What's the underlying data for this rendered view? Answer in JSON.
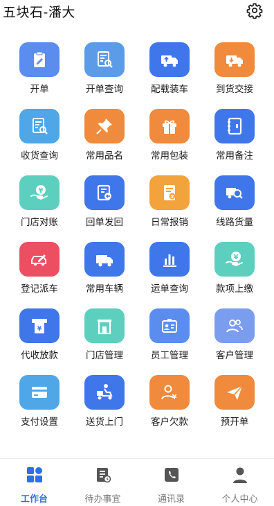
{
  "header": {
    "title": "五块石-潘大",
    "settings_icon": "gear-icon"
  },
  "colors": {
    "accent": "#2f6fe6",
    "tab_inactive": "#777777"
  },
  "grid": [
    {
      "label": "开单",
      "icon": "clipboard-pen-icon",
      "color": "#5b8def"
    },
    {
      "label": "开单查询",
      "icon": "document-search-icon",
      "color": "#5b9be8"
    },
    {
      "label": "配载装车",
      "icon": "truck-load-icon",
      "color": "#3f76ea"
    },
    {
      "label": "到货交接",
      "icon": "truck-unload-icon",
      "color": "#f08a3c"
    },
    {
      "label": "收货查询",
      "icon": "document-search-icon",
      "color": "#4fa7e8"
    },
    {
      "label": "常用品名",
      "icon": "pin-icon",
      "color": "#f08a3c"
    },
    {
      "label": "常用包装",
      "icon": "gift-box-icon",
      "color": "#f08a3c"
    },
    {
      "label": "常用备注",
      "icon": "notebook-icon",
      "color": "#3f76ea"
    },
    {
      "label": "门店对账",
      "icon": "yen-hand-icon",
      "color": "#5ccfbf"
    },
    {
      "label": "回单发回",
      "icon": "receipt-return-icon",
      "color": "#3f76ea"
    },
    {
      "label": "日常报销",
      "icon": "expense-receipt-icon",
      "color": "#f2a33c"
    },
    {
      "label": "线路货量",
      "icon": "truck-search-icon",
      "color": "#3f76ea"
    },
    {
      "label": "登记派车",
      "icon": "vehicle-register-icon",
      "color": "#ec4e62"
    },
    {
      "label": "常用车辆",
      "icon": "truck-icon",
      "color": "#3f76ea"
    },
    {
      "label": "运单查询",
      "icon": "bar-chart-icon",
      "color": "#3f76ea"
    },
    {
      "label": "款项上缴",
      "icon": "yen-hand-icon",
      "color": "#5ccfbf"
    },
    {
      "label": "代收放款",
      "icon": "atm-yen-icon",
      "color": "#3f76ea"
    },
    {
      "label": "门店管理",
      "icon": "store-icon",
      "color": "#5ccfbf"
    },
    {
      "label": "员工管理",
      "icon": "id-badge-icon",
      "color": "#5b8def"
    },
    {
      "label": "客户管理",
      "icon": "users-icon",
      "color": "#7a9df0"
    },
    {
      "label": "支付设置",
      "icon": "credit-card-icon",
      "color": "#4fa7e8"
    },
    {
      "label": "送货上门",
      "icon": "delivery-scooter-icon",
      "color": "#3f76ea"
    },
    {
      "label": "客户欠款",
      "icon": "user-debt-icon",
      "color": "#f08a3c"
    },
    {
      "label": "预开单",
      "icon": "paper-plane-icon",
      "color": "#f08a3c"
    }
  ],
  "tabbar": [
    {
      "label": "工作台",
      "icon": "workbench-grid-icon",
      "active": true
    },
    {
      "label": "待办事宜",
      "icon": "todo-list-icon",
      "active": false
    },
    {
      "label": "通讯录",
      "icon": "phone-book-icon",
      "active": false
    },
    {
      "label": "个人中心",
      "icon": "user-icon",
      "active": false
    }
  ]
}
